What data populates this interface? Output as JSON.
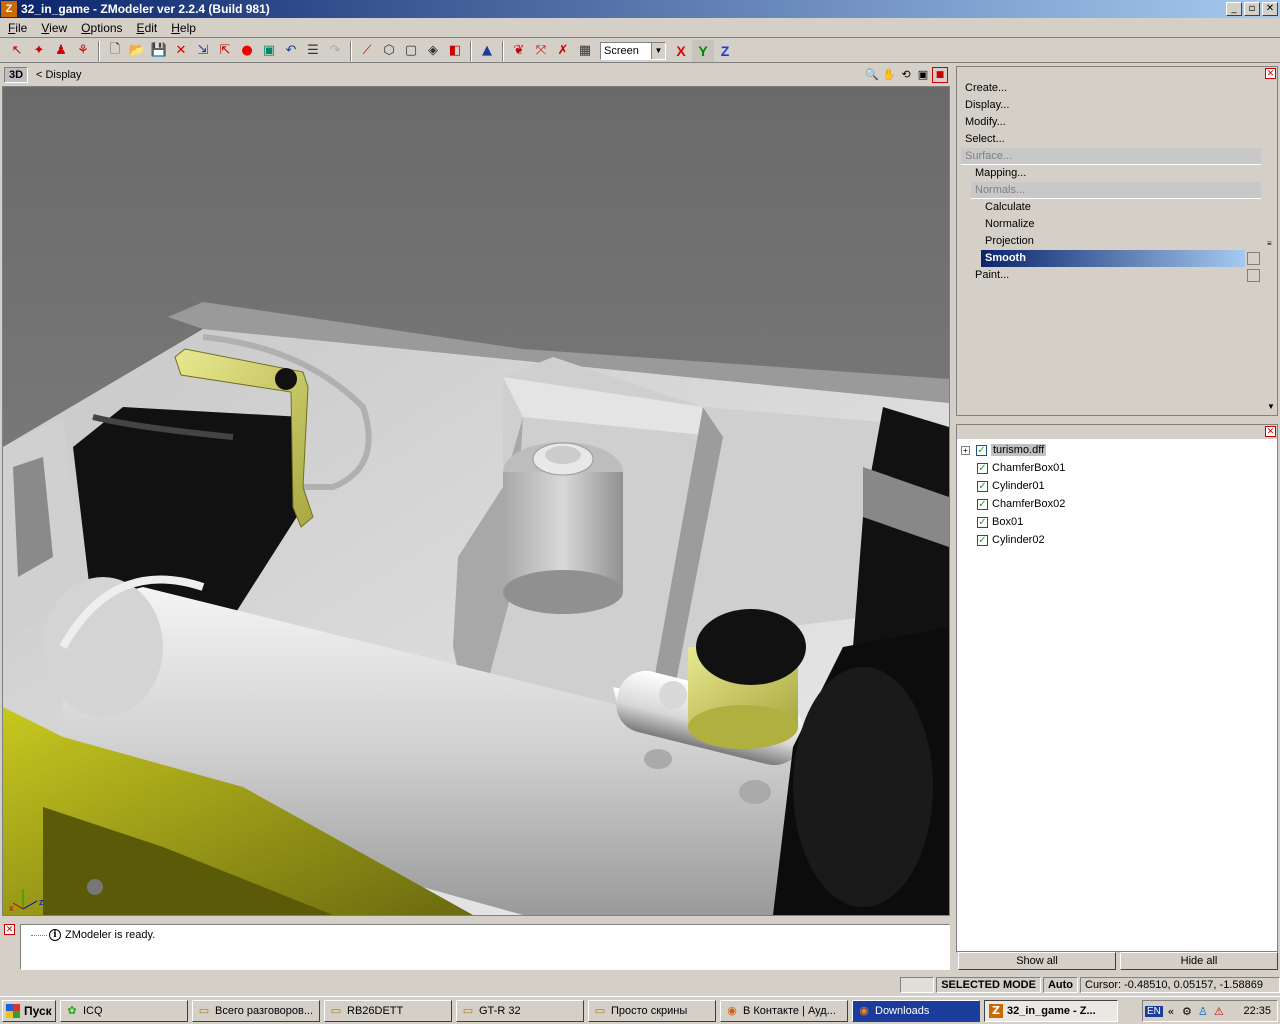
{
  "window": {
    "title": "32_in_game - ZModeler ver 2.2.4 (Build 981)",
    "app_icon": "Z",
    "buttons": [
      "_",
      "▫",
      "✕"
    ]
  },
  "menu": [
    {
      "label": "File",
      "accel": "F",
      "rest": "ile"
    },
    {
      "label": "View",
      "accel": "V",
      "rest": "iew"
    },
    {
      "label": "Options",
      "accel": "O",
      "rest": "ptions"
    },
    {
      "label": "Edit",
      "accel": "E",
      "rest": "dit"
    },
    {
      "label": "Help",
      "accel": "H",
      "rest": "elp"
    }
  ],
  "toolbar": {
    "coord_system": "Screen",
    "axis_x": "X",
    "axis_y": "Y",
    "axis_z": "Z"
  },
  "viewport": {
    "mode": "3D",
    "view": "< Display",
    "axis_labels": {
      "x": "x",
      "z": "z"
    }
  },
  "command_panel": {
    "items": [
      {
        "label": "Create...",
        "level": 0,
        "state": "normal"
      },
      {
        "label": "Display...",
        "level": 0,
        "state": "normal"
      },
      {
        "label": "Modify...",
        "level": 0,
        "state": "normal"
      },
      {
        "label": "Select...",
        "level": 0,
        "state": "normal"
      },
      {
        "label": "Surface...",
        "level": 0,
        "state": "disabled"
      },
      {
        "label": "Mapping...",
        "level": 1,
        "state": "normal"
      },
      {
        "label": "Normals...",
        "level": 1,
        "state": "disabled"
      },
      {
        "label": "Calculate",
        "level": 2,
        "state": "normal"
      },
      {
        "label": "Normalize",
        "level": 2,
        "state": "normal"
      },
      {
        "label": "Projection",
        "level": 2,
        "state": "normal"
      },
      {
        "label": "Smooth",
        "level": 2,
        "state": "selected"
      },
      {
        "label": "Paint...",
        "level": 1,
        "state": "normal"
      }
    ]
  },
  "objects": {
    "root": "turismo.dff",
    "items": [
      "ChamferBox01",
      "Cylinder01",
      "ChamferBox02",
      "Box01",
      "Cylinder02"
    ],
    "show_all": "Show all",
    "hide_all": "Hide all"
  },
  "log": {
    "message": "ZModeler is ready."
  },
  "status": {
    "mode": "SELECTED MODE",
    "auto": "Auto",
    "cursor": "Cursor: -0.48510, 0.05157, -1.58869"
  },
  "taskbar": {
    "start": "Пуск",
    "tasks": [
      {
        "label": "ICQ",
        "icon": "✿",
        "active": false
      },
      {
        "label": "Всего разговоров...",
        "icon": "▭",
        "active": false
      },
      {
        "label": "RB26DETT",
        "icon": "▭",
        "active": false
      },
      {
        "label": "GT-R 32",
        "icon": "▭",
        "active": false
      },
      {
        "label": "Просто скрины",
        "icon": "▭",
        "active": false
      },
      {
        "label": "В Контакте | Ауд...",
        "icon": "◉",
        "active": false
      },
      {
        "label": "Downloads",
        "icon": "◉",
        "active": false
      },
      {
        "label": "32_in_game - Z...",
        "icon": "Z",
        "active": true
      }
    ],
    "lang": "EN",
    "clock": "22:35"
  }
}
